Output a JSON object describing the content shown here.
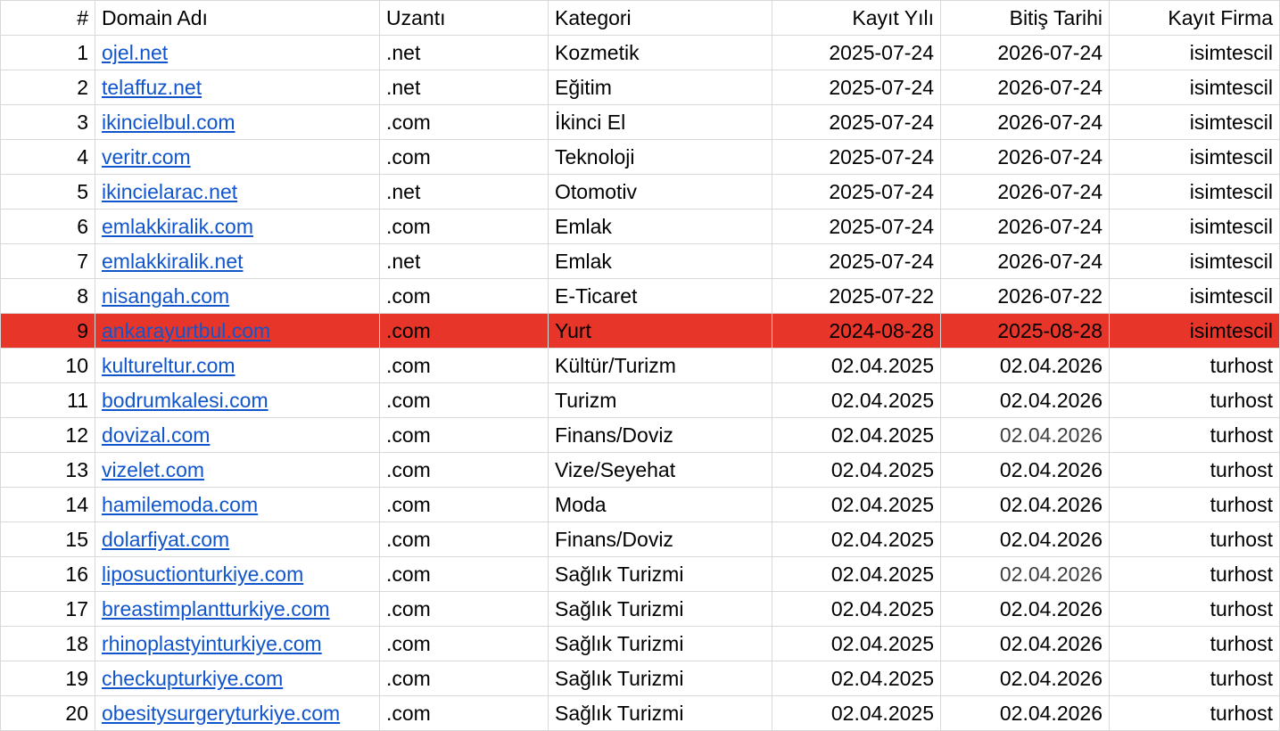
{
  "headers": {
    "num": "#",
    "domain": "Domain Adı",
    "ext": "Uzantı",
    "category": "Kategori",
    "reg_year": "Kayıt Yılı",
    "end_date": "Bitiş Tarihi",
    "registrar": "Kayıt Firma"
  },
  "highlight_color": "#e8352a",
  "link_color": "#1155cc",
  "rows": [
    {
      "num": "1",
      "domain": "ojel.net",
      "ext": ".net",
      "category": "Kozmetik",
      "reg": "2025-07-24",
      "end": "2026-07-24",
      "firm": "isimtescil"
    },
    {
      "num": "2",
      "domain": "telaffuz.net",
      "ext": ".net",
      "category": "Eğitim",
      "reg": "2025-07-24",
      "end": "2026-07-24",
      "firm": "isimtescil"
    },
    {
      "num": "3",
      "domain": "ikincielbul.com",
      "ext": ".com",
      "category": "İkinci El",
      "reg": "2025-07-24",
      "end": "2026-07-24",
      "firm": "isimtescil"
    },
    {
      "num": "4",
      "domain": "veritr.com",
      "ext": ".com",
      "category": "Teknoloji",
      "reg": "2025-07-24",
      "end": "2026-07-24",
      "firm": "isimtescil"
    },
    {
      "num": "5",
      "domain": "ikincielarac.net",
      "ext": ".net",
      "category": "Otomotiv",
      "reg": "2025-07-24",
      "end": "2026-07-24",
      "firm": "isimtescil"
    },
    {
      "num": "6",
      "domain": "emlakkiralik.com",
      "ext": ".com",
      "category": "Emlak",
      "reg": "2025-07-24",
      "end": "2026-07-24",
      "firm": "isimtescil"
    },
    {
      "num": "7",
      "domain": "emlakkiralik.net",
      "ext": ".net",
      "category": "Emlak",
      "reg": "2025-07-24",
      "end": "2026-07-24",
      "firm": "isimtescil"
    },
    {
      "num": "8",
      "domain": "nisangah.com",
      "ext": ".com",
      "category": "E-Ticaret",
      "reg": "2025-07-22",
      "end": "2026-07-22",
      "firm": "isimtescil"
    },
    {
      "num": "9",
      "domain": "ankarayurtbul.com",
      "ext": ".com",
      "category": "Yurt",
      "reg": "2024-08-28",
      "end": "2025-08-28",
      "firm": "isimtescil",
      "highlight": true
    },
    {
      "num": "10",
      "domain": "kultureltur.com",
      "ext": ".com",
      "category": "Kültür/Turizm",
      "reg": "02.04.2025",
      "end": "02.04.2026",
      "firm": "turhost"
    },
    {
      "num": "11",
      "domain": "bodrumkalesi.com",
      "ext": ".com",
      "category": "Turizm",
      "reg": "02.04.2025",
      "end": "02.04.2026",
      "firm": "turhost"
    },
    {
      "num": "12",
      "domain": "dovizal.com",
      "ext": ".com",
      "category": "Finans/Doviz",
      "reg": "02.04.2025",
      "end": "02.04.2026",
      "firm": "turhost",
      "end_muted": true
    },
    {
      "num": "13",
      "domain": "vizelet.com",
      "ext": ".com",
      "category": "Vize/Seyehat",
      "reg": "02.04.2025",
      "end": "02.04.2026",
      "firm": "turhost"
    },
    {
      "num": "14",
      "domain": "hamilemoda.com",
      "ext": ".com",
      "category": "Moda",
      "reg": "02.04.2025",
      "end": "02.04.2026",
      "firm": "turhost"
    },
    {
      "num": "15",
      "domain": "dolarfiyat.com",
      "ext": ".com",
      "category": "Finans/Doviz",
      "reg": "02.04.2025",
      "end": "02.04.2026",
      "firm": "turhost"
    },
    {
      "num": "16",
      "domain": "liposuctionturkiye.com",
      "ext": ".com",
      "category": "Sağlık Turizmi",
      "reg": "02.04.2025",
      "end": "02.04.2026",
      "firm": "turhost",
      "end_muted": true
    },
    {
      "num": "17",
      "domain": "breastimplantturkiye.com",
      "ext": ".com",
      "category": "Sağlık Turizmi",
      "reg": "02.04.2025",
      "end": "02.04.2026",
      "firm": "turhost"
    },
    {
      "num": "18",
      "domain": "rhinoplastyinturkiye.com",
      "ext": ".com",
      "category": "Sağlık Turizmi",
      "reg": "02.04.2025",
      "end": "02.04.2026",
      "firm": "turhost"
    },
    {
      "num": "19",
      "domain": "checkupturkiye.com",
      "ext": ".com",
      "category": "Sağlık Turizmi",
      "reg": "02.04.2025",
      "end": "02.04.2026",
      "firm": "turhost"
    },
    {
      "num": "20",
      "domain": "obesitysurgeryturkiye.com",
      "ext": ".com",
      "category": "Sağlık Turizmi",
      "reg": "02.04.2025",
      "end": "02.04.2026",
      "firm": "turhost"
    }
  ]
}
